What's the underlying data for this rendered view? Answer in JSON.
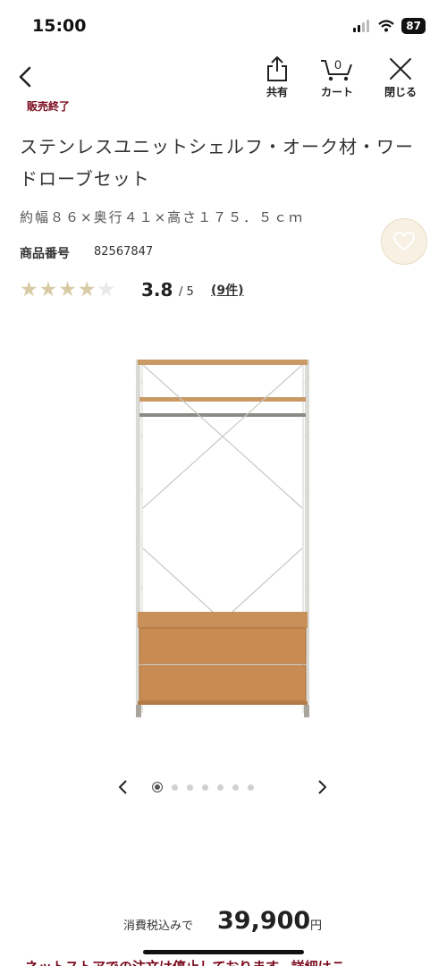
{
  "status_bar": {
    "time": "15:00",
    "battery": "87"
  },
  "nav": {
    "share_label": "共有",
    "cart_label": "カート",
    "cart_count": "0",
    "close_label": "閉じる"
  },
  "sold_out": "販売終了",
  "product": {
    "title": "ステンレスユニットシェルフ・オーク材・ワードローブセット",
    "dimensions": "約幅８６×奥行４１×高さ１７５．５ｃｍ",
    "code_label": "商品番号",
    "code": "82567847",
    "rating": "3.8",
    "rating_max": "/ 5",
    "reviews": "(9件)",
    "rating_value": 3.8
  },
  "carousel": {
    "total": 7,
    "active": 1
  },
  "price": {
    "label": "消費税込みで",
    "value": "39,900",
    "unit": "円"
  },
  "notice": "ネットストアでの注文は停止しております。詳細はこ",
  "colors": {
    "accent": "#7a0a1e",
    "star": "#d8cba5",
    "fav_bg": "#f8f1e3"
  },
  "icons": {
    "back": "chevron-left-icon",
    "share": "share-icon",
    "cart": "cart-icon",
    "close": "close-icon",
    "favorite": "heart-icon"
  }
}
